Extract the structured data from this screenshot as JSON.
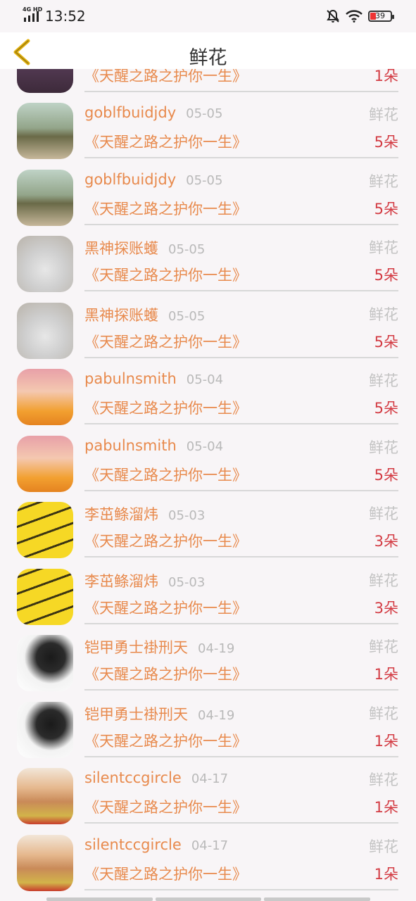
{
  "status_bar": {
    "network": "4G HD",
    "time": "13:52",
    "battery": "39"
  },
  "header": {
    "title": "鲜花"
  },
  "rows": [
    {
      "name": "",
      "date": "",
      "type": "",
      "book": "《天醒之路之护你一生》",
      "count": "1朵",
      "avatar": "portrait-dark"
    },
    {
      "name": "goblfbuidjdy",
      "date": "05-05",
      "type": "鲜花",
      "book": "《天醒之路之护你一生》",
      "count": "5朵",
      "avatar": "landscape"
    },
    {
      "name": "goblfbuidjdy",
      "date": "05-05",
      "type": "鲜花",
      "book": "《天醒之路之护你一生》",
      "count": "5朵",
      "avatar": "landscape"
    },
    {
      "name": "黑神探账蠖",
      "date": "05-05",
      "type": "鲜花",
      "book": "《天醒之路之护你一生》",
      "count": "5朵",
      "avatar": "rabbit"
    },
    {
      "name": "黑神探账蠖",
      "date": "05-05",
      "type": "鲜花",
      "book": "《天醒之路之护你一生》",
      "count": "5朵",
      "avatar": "rabbit"
    },
    {
      "name": "pabulnsmith",
      "date": "05-04",
      "type": "鲜花",
      "book": "《天醒之路之护你一生》",
      "count": "5朵",
      "avatar": "cartoon-girl"
    },
    {
      "name": "pabulnsmith",
      "date": "05-04",
      "type": "鲜花",
      "book": "《天醒之路之护你一生》",
      "count": "5朵",
      "avatar": "cartoon-girl"
    },
    {
      "name": "李茁鲦溜炜",
      "date": "05-03",
      "type": "鲜花",
      "book": "《天醒之路之护你一生》",
      "count": "3朵",
      "avatar": "yellow-drawing"
    },
    {
      "name": "李茁鲦溜炜",
      "date": "05-03",
      "type": "鲜花",
      "book": "《天醒之路之护你一生》",
      "count": "3朵",
      "avatar": "yellow-drawing"
    },
    {
      "name": "铠甲勇士褂刑天",
      "date": "04-19",
      "type": "鲜花",
      "book": "《天醒之路之护你一生》",
      "count": "1朵",
      "avatar": "bw-woman"
    },
    {
      "name": "铠甲勇士褂刑天",
      "date": "04-19",
      "type": "鲜花",
      "book": "《天醒之路之护你一生》",
      "count": "1朵",
      "avatar": "bw-woman"
    },
    {
      "name": "silentccgircle",
      "date": "04-17",
      "type": "鲜花",
      "book": "《天醒之路之护你一生》",
      "count": "1朵",
      "avatar": "doll-girl"
    },
    {
      "name": "silentccgircle",
      "date": "04-17",
      "type": "鲜花",
      "book": "《天醒之路之护你一生》",
      "count": "1朵",
      "avatar": "doll-girl"
    }
  ],
  "colors": {
    "name": "#e88a4d",
    "count": "#d33b43",
    "muted": "#b9b9b9",
    "background": "#f8f5f7"
  }
}
